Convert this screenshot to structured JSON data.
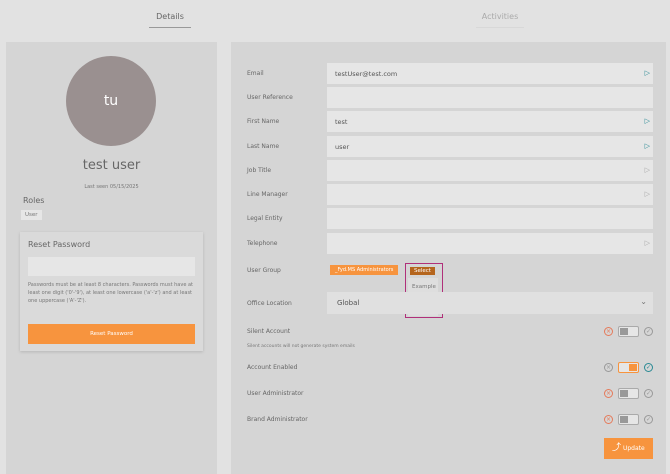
{
  "tabs": [
    {
      "label": "Details",
      "active": true
    },
    {
      "label": "Activities",
      "active": false
    }
  ],
  "profile": {
    "initials": "tu",
    "name": "test user",
    "last_seen": "Last seen 05/15/2025",
    "roles_title": "Roles",
    "roles": [
      "User"
    ]
  },
  "reset_password": {
    "title": "Reset Password",
    "value": "",
    "hint": "Passwords must be at least 8 characters. Passwords must have at least one digit ('0'-'9'), at least one lowercase ('a'-'z') and at least one uppercase ('A'-'Z').",
    "button": "Reset Password"
  },
  "fields": [
    {
      "label": "Email",
      "value": "testUser@test.com",
      "icon": "active"
    },
    {
      "label": "User Reference",
      "value": "",
      "icon": ""
    },
    {
      "label": "First Name",
      "value": "test",
      "icon": "active"
    },
    {
      "label": "Last Name",
      "value": "user",
      "icon": "active"
    },
    {
      "label": "Job Title",
      "value": "",
      "icon": "inactive"
    },
    {
      "label": "Line Manager",
      "value": "",
      "icon": "inactive"
    },
    {
      "label": "Legal Entity",
      "value": "",
      "icon": ""
    },
    {
      "label": "Telephone",
      "value": "",
      "icon": "inactive"
    }
  ],
  "user_group": {
    "label": "User Group",
    "tag": "_Fyd.MS Administrators",
    "select_label": "Select",
    "options": [
      "Example Child Group"
    ]
  },
  "office_location": {
    "label": "Office Location",
    "value": "Global"
  },
  "toggles": [
    {
      "label": "Silent Account",
      "note": "Silent accounts will not generate system emails",
      "on": false
    },
    {
      "label": "Account Enabled",
      "on": true
    },
    {
      "label": "User Administrator",
      "on": false
    },
    {
      "label": "Brand Administrator",
      "on": false
    }
  ],
  "update_button": "Update",
  "colors": {
    "accent": "#f7943e",
    "teal": "#2a8a94",
    "magenta": "#b0307a"
  }
}
